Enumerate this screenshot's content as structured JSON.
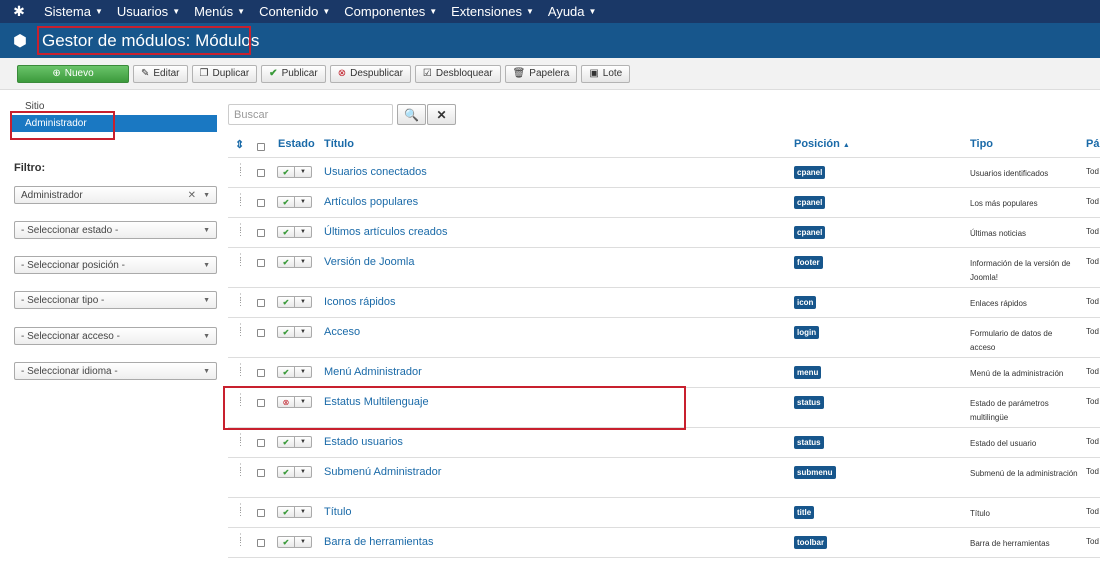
{
  "nav": {
    "items": [
      "Sistema",
      "Usuarios",
      "Menús",
      "Contenido",
      "Componentes",
      "Extensiones",
      "Ayuda"
    ]
  },
  "header": {
    "title": "Gestor de módulos: Módulos"
  },
  "toolbar": {
    "new": "Nuevo",
    "edit": "Editar",
    "duplicate": "Duplicar",
    "publish": "Publicar",
    "unpublish": "Despublicar",
    "unlock": "Desbloquear",
    "trash": "Papelera",
    "batch": "Lote"
  },
  "sidebar": {
    "site": "Sitio",
    "admin": "Administrador",
    "filter_label": "Filtro:",
    "client_select": "Administrador",
    "state_select": "- Seleccionar estado -",
    "position_select": "- Seleccionar posición -",
    "type_select": "- Seleccionar tipo -",
    "access_select": "- Seleccionar acceso -",
    "language_select": "- Seleccionar idioma -"
  },
  "search": {
    "placeholder": "Buscar"
  },
  "table": {
    "headers": {
      "estado": "Estado",
      "titulo": "Título",
      "posicion": "Posición",
      "tipo": "Tipo",
      "paginas": "Pág"
    },
    "rows": [
      {
        "title": "Usuarios conectados",
        "position": "cpanel",
        "type": "Usuarios identificados",
        "pages": "Tod",
        "published": true
      },
      {
        "title": "Artículos populares",
        "position": "cpanel",
        "type": "Los más populares",
        "pages": "Tod",
        "published": true
      },
      {
        "title": "Últimos artículos creados",
        "position": "cpanel",
        "type": "Últimas noticias",
        "pages": "Tod",
        "published": true
      },
      {
        "title": "Versión de Joomla",
        "position": "footer",
        "type": "Información de la versión de Joomla!",
        "pages": "Tod",
        "published": true
      },
      {
        "title": "Iconos rápidos",
        "position": "icon",
        "type": "Enlaces rápidos",
        "pages": "Tod",
        "published": true
      },
      {
        "title": "Acceso",
        "position": "login",
        "type": "Formulario de datos de acceso",
        "pages": "Tod",
        "published": true
      },
      {
        "title": "Menú Administrador",
        "position": "menu",
        "type": "Menú de la administración",
        "pages": "Tod",
        "published": true
      },
      {
        "title": "Estatus Multilenguaje",
        "position": "status",
        "type": "Estado de parámetros multilingüe",
        "pages": "Tod",
        "published": false
      },
      {
        "title": "Estado usuarios",
        "position": "status",
        "type": "Estado del usuario",
        "pages": "Tod",
        "published": true
      },
      {
        "title": "Submenú Administrador",
        "position": "submenu",
        "type": "Submenú de la administración",
        "pages": "Tod",
        "published": true
      },
      {
        "title": "Título",
        "position": "title",
        "type": "Título",
        "pages": "Tod",
        "published": true
      },
      {
        "title": "Barra de herramientas",
        "position": "toolbar",
        "type": "Barra de herramientas",
        "pages": "Tod",
        "published": true
      }
    ]
  }
}
